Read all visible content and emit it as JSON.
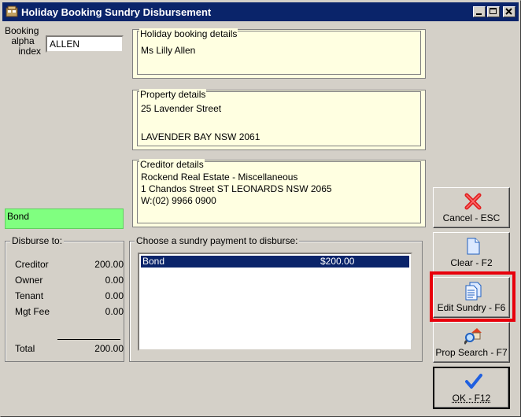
{
  "window": {
    "title": "Holiday Booking Sundry Disbursement"
  },
  "booking": {
    "label_lines": [
      "Booking",
      "alpha",
      "index"
    ],
    "value": "ALLEN"
  },
  "holiday_details": {
    "legend": "Holiday booking details",
    "lines": [
      "Ms Lilly Allen"
    ]
  },
  "property_details": {
    "legend": "Property details",
    "lines": [
      "25 Lavender Street",
      "",
      "LAVENDER BAY  NSW  2061"
    ]
  },
  "creditor_details": {
    "legend": "Creditor details",
    "lines": [
      "Rockend Real Estate - Miscellaneous",
      "1 Chandos Street ST LEONARDS NSW 2065",
      "W:(02) 9966 0900"
    ]
  },
  "selected_sundry": "Bond",
  "disburse": {
    "legend": "Disburse to:",
    "rows": [
      {
        "label": "Creditor",
        "value": "200.00"
      },
      {
        "label": "Owner",
        "value": "0.00"
      },
      {
        "label": "Tenant",
        "value": "0.00"
      },
      {
        "label": "Mgt Fee",
        "value": "0.00"
      }
    ],
    "total_label": "Total",
    "total_value": "200.00"
  },
  "sundry_list": {
    "legend": "Choose a sundry payment to disburse:",
    "items": [
      {
        "name": "Bond",
        "amount": "$200.00"
      }
    ]
  },
  "buttons": {
    "cancel": "Cancel - ESC",
    "clear": "Clear - F2",
    "edit_sundry": "Edit Sundry - F6",
    "prop_search": "Prop Search - F7",
    "ok": "OK - F12"
  },
  "colors": {
    "titlebar": "#0a246a",
    "highlight_box": "#e8000b",
    "bond_panel": "#80ff80",
    "details_bg": "#ffffe1"
  }
}
